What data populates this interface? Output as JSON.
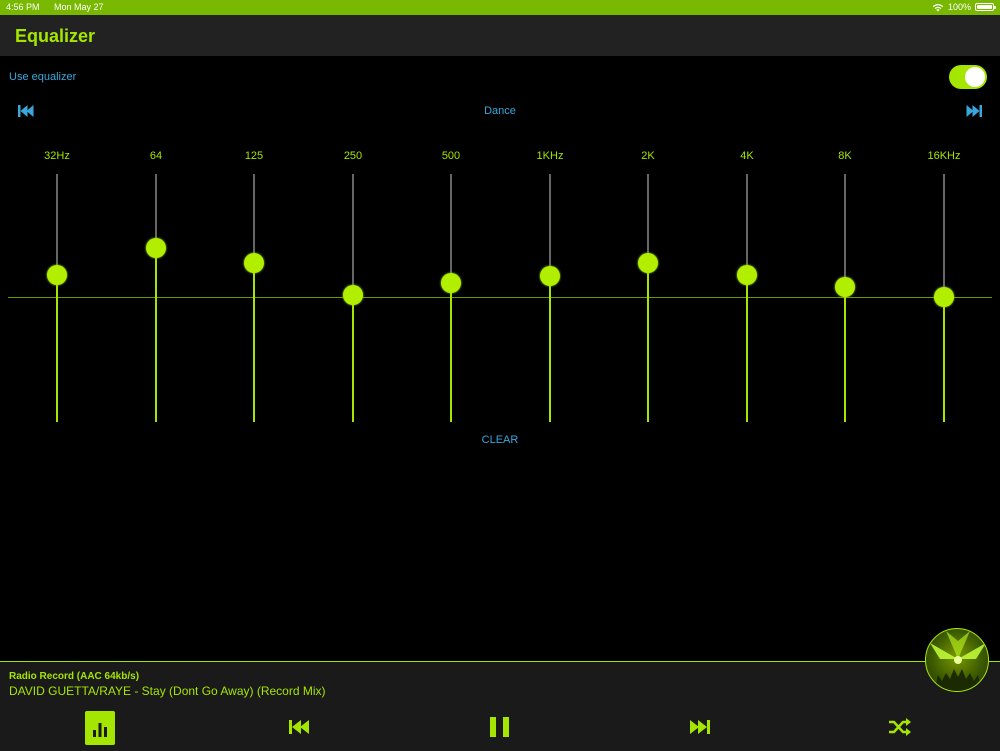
{
  "status_bar": {
    "time": "4:56 PM",
    "date": "Mon May 27",
    "battery": "100%"
  },
  "nav": {
    "title": "Equalizer"
  },
  "settings": {
    "use_equalizer_label": "Use equalizer",
    "use_equalizer_on": true
  },
  "preset": {
    "name": "Dance",
    "prev_icon": "skip-previous-icon",
    "next_icon": "skip-next-icon"
  },
  "bands": [
    {
      "label": "32Hz",
      "level": 0.24
    },
    {
      "label": "64",
      "level": 0.54
    },
    {
      "label": "125",
      "level": 0.38
    },
    {
      "label": "250",
      "level": 0.02
    },
    {
      "label": "500",
      "level": 0.16
    },
    {
      "label": "1KHz",
      "level": 0.23
    },
    {
      "label": "2K",
      "level": 0.38
    },
    {
      "label": "4K",
      "level": 0.24
    },
    {
      "label": "8K",
      "level": 0.11
    },
    {
      "label": "16KHz",
      "level": 0.0
    }
  ],
  "clear_label": "CLEAR",
  "player": {
    "station": "Radio Record (AAC 64kb/s)",
    "track": "DAVID GUETTA/RAYE - Stay (Dont Go Away) (Record Mix)",
    "controls": [
      "equalizer-icon",
      "rewind-icon",
      "pause-icon",
      "fast-forward-icon",
      "shuffle-icon"
    ]
  },
  "colors": {
    "accent": "#a5e600",
    "link": "#3aa7dc",
    "status_bar": "#78b800"
  }
}
